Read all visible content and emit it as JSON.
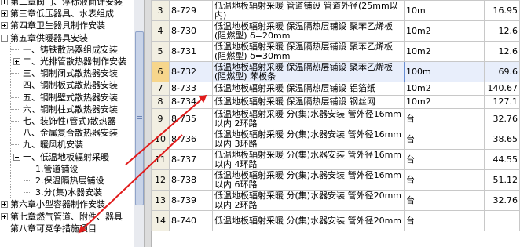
{
  "tree": {
    "nodes": [
      {
        "label": "第二章阀门、浮标液面计安装",
        "level": 0,
        "exp": "plus"
      },
      {
        "label": "第三章低压器具、水表组成",
        "level": 0,
        "exp": "plus"
      },
      {
        "label": "第四章卫生器具制作安装",
        "level": 0,
        "exp": "plus"
      },
      {
        "label": "第五章供暖器具安装",
        "level": 0,
        "exp": "minus"
      },
      {
        "label": "一、铸铁散热器组成安装",
        "level": 1,
        "exp": "none"
      },
      {
        "label": "二、光排管散热器制作安装",
        "level": 1,
        "exp": "plus"
      },
      {
        "label": "三、钢制闭式散热器安装",
        "level": 1,
        "exp": "none"
      },
      {
        "label": "四、钢制板式散热器安装",
        "level": 1,
        "exp": "none"
      },
      {
        "label": "五、钢制壁式散热器安装",
        "level": 1,
        "exp": "none"
      },
      {
        "label": "六、钢制柱式散热器安装",
        "level": 1,
        "exp": "none"
      },
      {
        "label": "七、装饰性(管式)散热器",
        "level": 1,
        "exp": "none"
      },
      {
        "label": "八、金属复合散热器安装",
        "level": 1,
        "exp": "none"
      },
      {
        "label": "九、暖风机安装",
        "level": 1,
        "exp": "none"
      },
      {
        "label": "十、低温地板辐射采暖",
        "level": 1,
        "exp": "minus"
      },
      {
        "label": "1.管道铺设",
        "level": 2,
        "exp": "none"
      },
      {
        "label": "2.保温隔热层铺设",
        "level": 2,
        "exp": "none"
      },
      {
        "label": "3.分(集)水器安装",
        "level": 2,
        "exp": "none"
      },
      {
        "label": "第六章小型容器制作安装",
        "level": 0,
        "exp": "plus"
      },
      {
        "label": "第七章燃气管道、附件、器具",
        "level": 0,
        "exp": "plus"
      },
      {
        "label": "第八章可竞争措施项目",
        "level": 0,
        "exp": "none"
      }
    ]
  },
  "grid": {
    "rows": [
      {
        "num": "3",
        "code": "8-729",
        "name": "低温地板辐射采暖 管道铺设 管道外径(25mm以内)",
        "unit": "10m",
        "blank": "",
        "qty": "16.95",
        "lines": 2
      },
      {
        "num": "4",
        "code": "8-730",
        "name": "低温地板辐射采暖 保温隔热层铺设 聚苯乙烯板(阻燃型) δ=20mm",
        "unit": "10m2",
        "blank": "",
        "qty": "12.6",
        "lines": 2
      },
      {
        "num": "5",
        "code": "8-731",
        "name": "低温地板辐射采暖 保温隔热层铺设 聚苯乙烯板(阻燃型) δ=30mm",
        "unit": "10m2",
        "blank": "",
        "qty": "12.6",
        "lines": 2
      },
      {
        "num": "6",
        "code": "8-732",
        "name": "低温地板辐射采暖 保温隔热层铺设 聚苯乙烯板(阻燃型) 苯板条",
        "unit": "100m",
        "blank": "",
        "qty": "69.6",
        "lines": 2,
        "highlight": true
      },
      {
        "num": "7",
        "code": "8-733",
        "name": "低温地板辐射采暖 保温隔热层铺设 铝箔纸",
        "unit": "10m2",
        "blank": "",
        "qty": "140.67",
        "lines": 1
      },
      {
        "num": "8",
        "code": "8-734",
        "name": "低温地板辐射采暖 保温隔热层铺设 钢丝网",
        "unit": "10m2",
        "blank": "",
        "qty": "127.1",
        "lines": 1
      },
      {
        "num": "9",
        "code": "8-735",
        "name": "低温地板辐射采暖 分(集)水器安装 管外径16mm以内 2环路",
        "unit": "台",
        "blank": "",
        "qty": "32.76",
        "lines": 2
      },
      {
        "num": "10",
        "code": "8-736",
        "name": "低温地板辐射采暖 分(集)水器安装 管外径16mm以内 3环路",
        "unit": "台",
        "blank": "",
        "qty": "38.65",
        "lines": 2
      },
      {
        "num": "11",
        "code": "8-737",
        "name": "低温地板辐射采暖 分(集)水器安装 管外径16mm以内 4环路",
        "unit": "台",
        "blank": "",
        "qty": "44.55",
        "lines": 2
      },
      {
        "num": "12",
        "code": "8-738",
        "name": "低温地板辐射采暖 分(集)水器安装 管外径16mm以内 6环路",
        "unit": "台",
        "blank": "",
        "qty": "51.12",
        "lines": 2
      },
      {
        "num": "13",
        "code": "8-739",
        "name": "低温地板辐射采暖 分(集)水器安装 管外径20mm以内 2环路",
        "unit": "台",
        "blank": "",
        "qty": "32.76",
        "lines": 2
      },
      {
        "num": "14",
        "code": "8-740",
        "name": "低温地板辐射采暖 分(集)水器安装 管外径20mm",
        "unit": "台",
        "blank": "",
        "qty": "",
        "lines": 2
      }
    ]
  },
  "annotation": {
    "arrow_color": "#e11b1b"
  }
}
